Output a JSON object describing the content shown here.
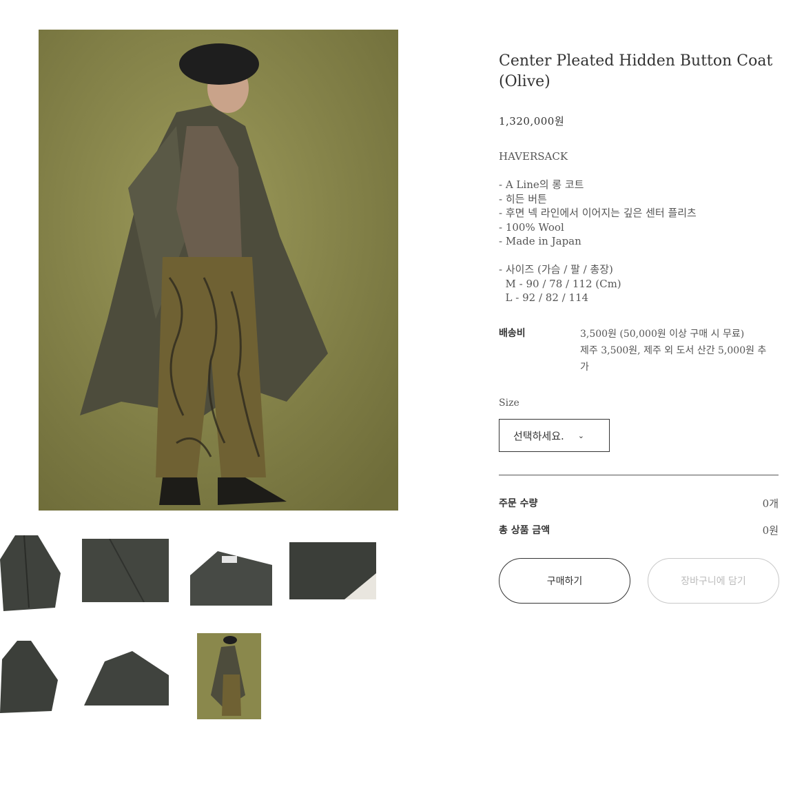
{
  "product": {
    "title": "Center Pleated Hidden Button Coat (Olive)",
    "price": "1,320,000원",
    "brand": "HAVERSACK",
    "description_lines": [
      "- A Line의 롱 코트",
      "- 히든 버튼",
      "- 후면 넥 라인에서 이어지는 깊은 센터 플리츠",
      "- 100% Wool",
      "- Made in Japan",
      "",
      "- 사이즈 (가슴 / 팔 / 총장)",
      "  M - 90 / 78 / 112 (Cm)",
      "  L - 92 / 82 / 114"
    ]
  },
  "shipping": {
    "label": "배송비",
    "line1": "3,500원 (50,000원 이상 구매 시 무료)",
    "line2": "제주 3,500원, 제주 외 도서 산간 5,000원 추가"
  },
  "size": {
    "label": "Size",
    "placeholder": "선택하세요."
  },
  "order": {
    "quantity_label": "주문 수량",
    "quantity_value": "0개",
    "total_label": "총 상품 금액",
    "total_value": "0원"
  },
  "buttons": {
    "buy": "구매하기",
    "cart": "장바구니에 담기"
  },
  "icons": {
    "select": "chevron-down-icon"
  },
  "colors": {
    "background": "#ffffff",
    "photo_backdrop": "#8a8a4c",
    "text_dark": "#333333",
    "disabled": "#bbbbbb"
  }
}
